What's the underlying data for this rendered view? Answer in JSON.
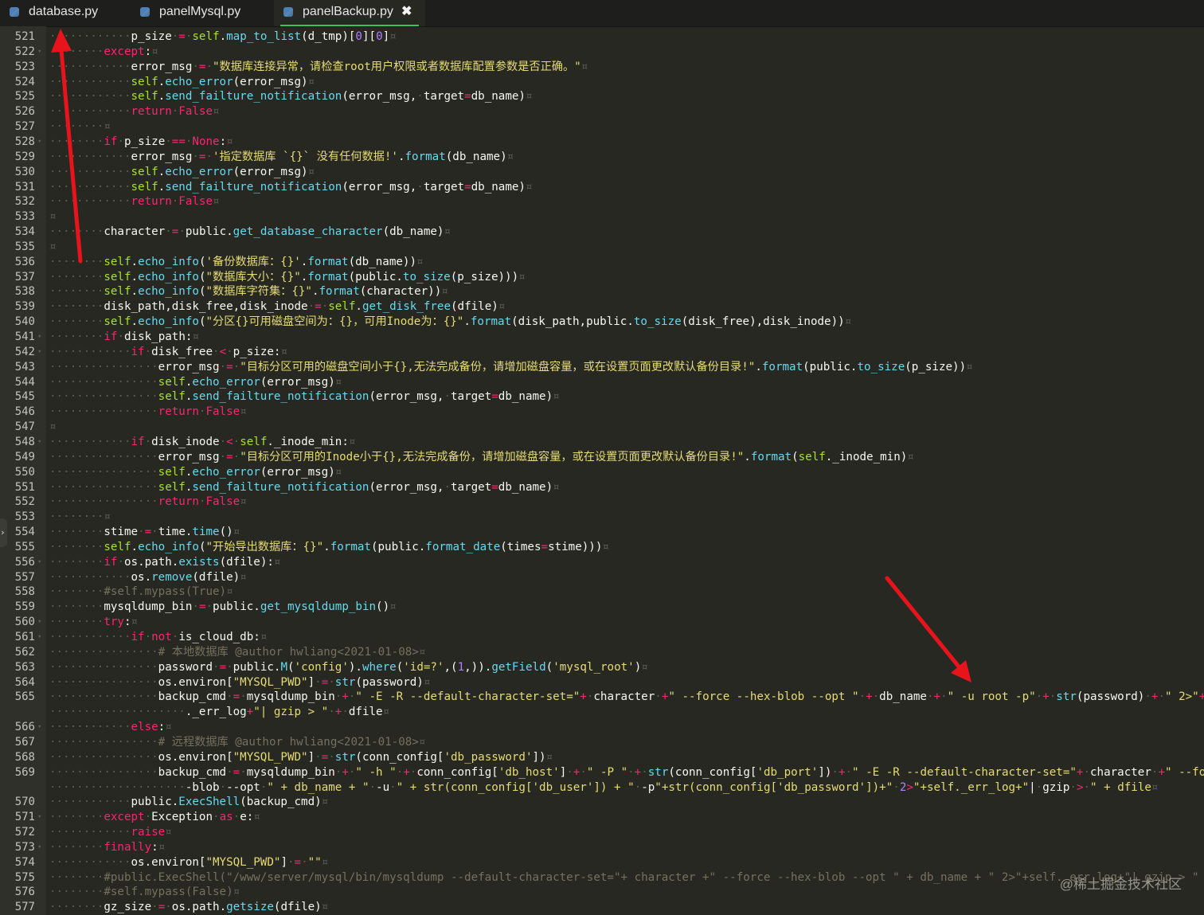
{
  "tabs": [
    {
      "name": "database.py",
      "active": false
    },
    {
      "name": "panelMysql.py",
      "active": false
    },
    {
      "name": "panelBackup.py",
      "active": true
    }
  ],
  "close_icon": "✖",
  "folded_toggle_icon": "chevron-right-icon",
  "watermark": "@稀土掘金技术社区",
  "colors": {
    "keyword": "#f92672",
    "self": "#a6e22e",
    "function": "#66d9ef",
    "string": "#e6db74",
    "number": "#ae81ff",
    "comment": "#75715e",
    "arrow": "#e8141b",
    "tab_underline": "#34c759"
  },
  "lines": [
    {
      "no": "521",
      "ind": "            ",
      "code": "p_size = self.map_to_list(d_tmp)[0][0]"
    },
    {
      "no": "522",
      "ind": "        ",
      "code": "except:",
      "fold": true
    },
    {
      "no": "523",
      "ind": "            ",
      "code": "error_msg = \"数据库连接异常，请检查root用户权限或者数据库配置参数是否正确。\""
    },
    {
      "no": "524",
      "ind": "            ",
      "code": "self.echo_error(error_msg)"
    },
    {
      "no": "525",
      "ind": "            ",
      "code": "self.send_failture_notification(error_msg, target=db_name)"
    },
    {
      "no": "526",
      "ind": "            ",
      "code": "return False"
    },
    {
      "no": "527",
      "ind": "        ",
      "code": ""
    },
    {
      "no": "528",
      "ind": "        ",
      "code": "if p_size == None:",
      "fold": true
    },
    {
      "no": "529",
      "ind": "            ",
      "code": "error_msg = '指定数据库 `{}` 没有任何数据!'.format(db_name)"
    },
    {
      "no": "530",
      "ind": "            ",
      "code": "self.echo_error(error_msg)"
    },
    {
      "no": "531",
      "ind": "            ",
      "code": "self.send_failture_notification(error_msg, target=db_name)"
    },
    {
      "no": "532",
      "ind": "            ",
      "code": "return False"
    },
    {
      "no": "533",
      "ind": "",
      "code": ""
    },
    {
      "no": "534",
      "ind": "        ",
      "code": "character = public.get_database_character(db_name)"
    },
    {
      "no": "535",
      "ind": "",
      "code": ""
    },
    {
      "no": "536",
      "ind": "        ",
      "code": "self.echo_info('备份数据库：{}'.format(db_name))"
    },
    {
      "no": "537",
      "ind": "        ",
      "code": "self.echo_info(\"数据库大小：{}\".format(public.to_size(p_size)))"
    },
    {
      "no": "538",
      "ind": "        ",
      "code": "self.echo_info(\"数据库字符集：{}\".format(character))"
    },
    {
      "no": "539",
      "ind": "        ",
      "code": "disk_path,disk_free,disk_inode = self.get_disk_free(dfile)"
    },
    {
      "no": "540",
      "ind": "        ",
      "code": "self.echo_info(\"分区{}可用磁盘空间为：{}，可用Inode为：{}\".format(disk_path,public.to_size(disk_free),disk_inode))"
    },
    {
      "no": "541",
      "ind": "        ",
      "code": "if disk_path:",
      "fold": true
    },
    {
      "no": "542",
      "ind": "            ",
      "code": "if disk_free < p_size:",
      "fold": true
    },
    {
      "no": "543",
      "ind": "                ",
      "code": "error_msg = \"目标分区可用的磁盘空间小于{},无法完成备份，请增加磁盘容量，或在设置页面更改默认备份目录!\".format(public.to_size(p_size))"
    },
    {
      "no": "544",
      "ind": "                ",
      "code": "self.echo_error(error_msg)"
    },
    {
      "no": "545",
      "ind": "                ",
      "code": "self.send_failture_notification(error_msg, target=db_name)"
    },
    {
      "no": "546",
      "ind": "                ",
      "code": "return False"
    },
    {
      "no": "547",
      "ind": "",
      "code": ""
    },
    {
      "no": "548",
      "ind": "            ",
      "code": "if disk_inode < self._inode_min:",
      "fold": true
    },
    {
      "no": "549",
      "ind": "                ",
      "code": "error_msg = \"目标分区可用的Inode小于{},无法完成备份，请增加磁盘容量，或在设置页面更改默认备份目录!\".format(self._inode_min)"
    },
    {
      "no": "550",
      "ind": "                ",
      "code": "self.echo_error(error_msg)"
    },
    {
      "no": "551",
      "ind": "                ",
      "code": "self.send_failture_notification(error_msg, target=db_name)"
    },
    {
      "no": "552",
      "ind": "                ",
      "code": "return False"
    },
    {
      "no": "553",
      "ind": "        ",
      "code": ""
    },
    {
      "no": "554",
      "ind": "        ",
      "code": "stime = time.time()"
    },
    {
      "no": "555",
      "ind": "        ",
      "code": "self.echo_info(\"开始导出数据库：{}\".format(public.format_date(times=stime)))"
    },
    {
      "no": "556",
      "ind": "        ",
      "code": "if os.path.exists(dfile):",
      "fold": true
    },
    {
      "no": "557",
      "ind": "            ",
      "code": "os.remove(dfile)"
    },
    {
      "no": "558",
      "ind": "        ",
      "code": "#self.mypass(True)"
    },
    {
      "no": "559",
      "ind": "        ",
      "code": "mysqldump_bin = public.get_mysqldump_bin()"
    },
    {
      "no": "560",
      "ind": "        ",
      "code": "try:",
      "fold": true
    },
    {
      "no": "561",
      "ind": "            ",
      "code": "if not is_cloud_db:",
      "fold": true
    },
    {
      "no": "562",
      "ind": "                ",
      "code": "# 本地数据库 @author hwliang<2021-01-08>"
    },
    {
      "no": "563",
      "ind": "                ",
      "code": "password = public.M('config').where('id=?',(1,)).getField('mysql_root')"
    },
    {
      "no": "564",
      "ind": "                ",
      "code": "os.environ[\"MYSQL_PWD\"] = str(password)"
    },
    {
      "no": "565",
      "ind": "                ",
      "code": "backup_cmd = mysqldump_bin + \" -E -R --default-character-set=\"+ character +\" --force --hex-blob --opt \" + db_name + \" -u root -p\" + str(password) + \" 2>\"+self"
    },
    {
      "no": "",
      "ind": "                    ",
      "code": "._err_log+\"| gzip > \" + dfile"
    },
    {
      "no": "566",
      "ind": "            ",
      "code": "else:",
      "fold": true
    },
    {
      "no": "567",
      "ind": "                ",
      "code": "# 远程数据库 @author hwliang<2021-01-08>"
    },
    {
      "no": "568",
      "ind": "                ",
      "code": "os.environ[\"MYSQL_PWD\"] = str(conn_config['db_password'])"
    },
    {
      "no": "569",
      "ind": "                ",
      "code": "backup_cmd = mysqldump_bin + \" -h \" + conn_config['db_host'] + \" -P \" + str(conn_config['db_port']) + \" -E -R --default-character-set=\"+ character +\" --force"
    },
    {
      "no": "",
      "ind": "                    ",
      "code": "-blob --opt \" + db_name + \" -u \" + str(conn_config['db_user']) + \" -p\"+str(conn_config['db_password'])+\" 2>\"+self._err_log+\"| gzip > \" + dfile"
    },
    {
      "no": "570",
      "ind": "            ",
      "code": "public.ExecShell(backup_cmd)"
    },
    {
      "no": "571",
      "ind": "        ",
      "code": "except Exception as e:",
      "fold": true
    },
    {
      "no": "572",
      "ind": "            ",
      "code": "raise"
    },
    {
      "no": "573",
      "ind": "        ",
      "code": "finally:",
      "fold": true
    },
    {
      "no": "574",
      "ind": "            ",
      "code": "os.environ[\"MYSQL_PWD\"] = \"\""
    },
    {
      "no": "575",
      "ind": "        ",
      "code": "#public.ExecShell(\"/www/server/mysql/bin/mysqldump --default-character-set=\"+ character +\" --force --hex-blob --opt \" + db_name + \" 2>\"+self._err_log+\"| gzip > \" + df"
    },
    {
      "no": "576",
      "ind": "        ",
      "code": "#self.mypass(False)"
    },
    {
      "no": "577",
      "ind": "        ",
      "code": "gz_size = os.path.getsize(dfile)"
    }
  ]
}
